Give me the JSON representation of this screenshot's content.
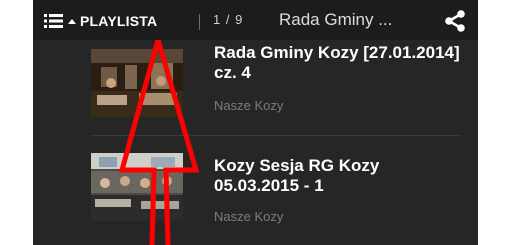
{
  "header": {
    "playlist_label": "PLAYLISTA",
    "counter": "1 / 9",
    "current_title": "Rada Gminy ...",
    "icons": {
      "menu": "list-icon",
      "caret": "caret-up-icon",
      "share": "share-icon"
    }
  },
  "playlist": [
    {
      "title": "Rada Gminy Kozy [27.01.2014] cz. 4",
      "source": "Nasze Kozy"
    },
    {
      "title": "Kozy Sesja RG Kozy 05.03.2015 - 1",
      "source": "Nasze Kozy"
    }
  ],
  "colors": {
    "panel_bg": "#262626",
    "topbar_bg": "#1c1c1c",
    "annotation_arrow": "#ff0000"
  }
}
